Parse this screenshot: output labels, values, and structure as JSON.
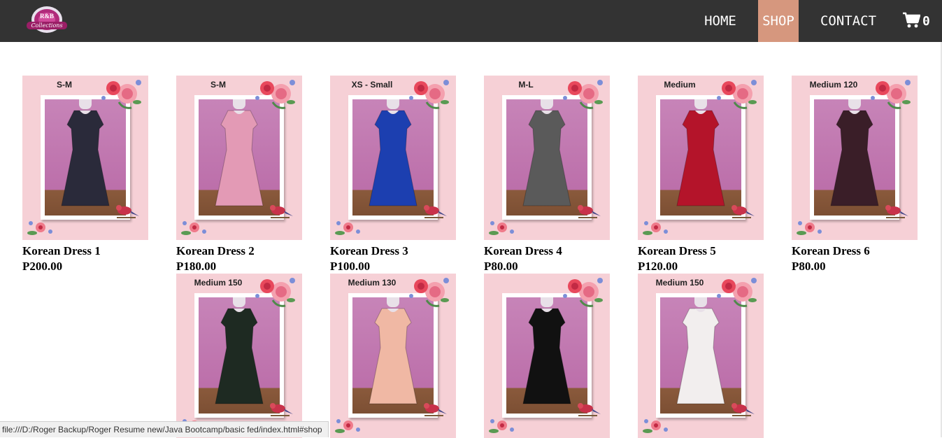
{
  "nav": {
    "logo_text": "R&B Collections",
    "links": [
      {
        "label": "HOME"
      },
      {
        "label": "SHOP",
        "active": true
      },
      {
        "label": "CONTACT"
      }
    ],
    "cart_count": "0"
  },
  "products": [
    {
      "size": "S-M",
      "name": "Korean Dress 1",
      "price": "P200.00",
      "dress_color": "#2a2a3a"
    },
    {
      "size": "S-M",
      "name": "Korean Dress 2",
      "price": "P180.00",
      "dress_color": "#e39ab5"
    },
    {
      "size": "XS - Small",
      "name": "Korean Dress 3",
      "price": "P100.00",
      "dress_color": "#1c3fb0"
    },
    {
      "size": "M-L",
      "name": "Korean Dress 4",
      "price": "P80.00",
      "dress_color": "#5a5a5a"
    },
    {
      "size": "Medium",
      "name": "Korean Dress 5",
      "price": "P120.00",
      "dress_color": "#b4142a"
    },
    {
      "size": "Medium 120",
      "name": "Korean Dress 6",
      "price": "P80.00",
      "dress_color": "#3a1e28"
    },
    {
      "size": "Medium 150",
      "name": "",
      "price": "",
      "dress_color": "#1e2a22"
    },
    {
      "size": "Medium 130",
      "name": "",
      "price": "",
      "dress_color": "#f0b8a4"
    },
    {
      "size": "",
      "name": "",
      "price": "",
      "dress_color": "#111111"
    },
    {
      "size": "Medium 150",
      "name": "",
      "price": "",
      "dress_color": "#f2eeee"
    }
  ],
  "status_bar": "file:///D:/Roger Backup/Roger Resume new/Java Bootcamp/basic fed/index.html#shop",
  "colors": {
    "navbar": "#333333",
    "active_nav": "#d6977e",
    "card_background": "#f6d0d6"
  }
}
